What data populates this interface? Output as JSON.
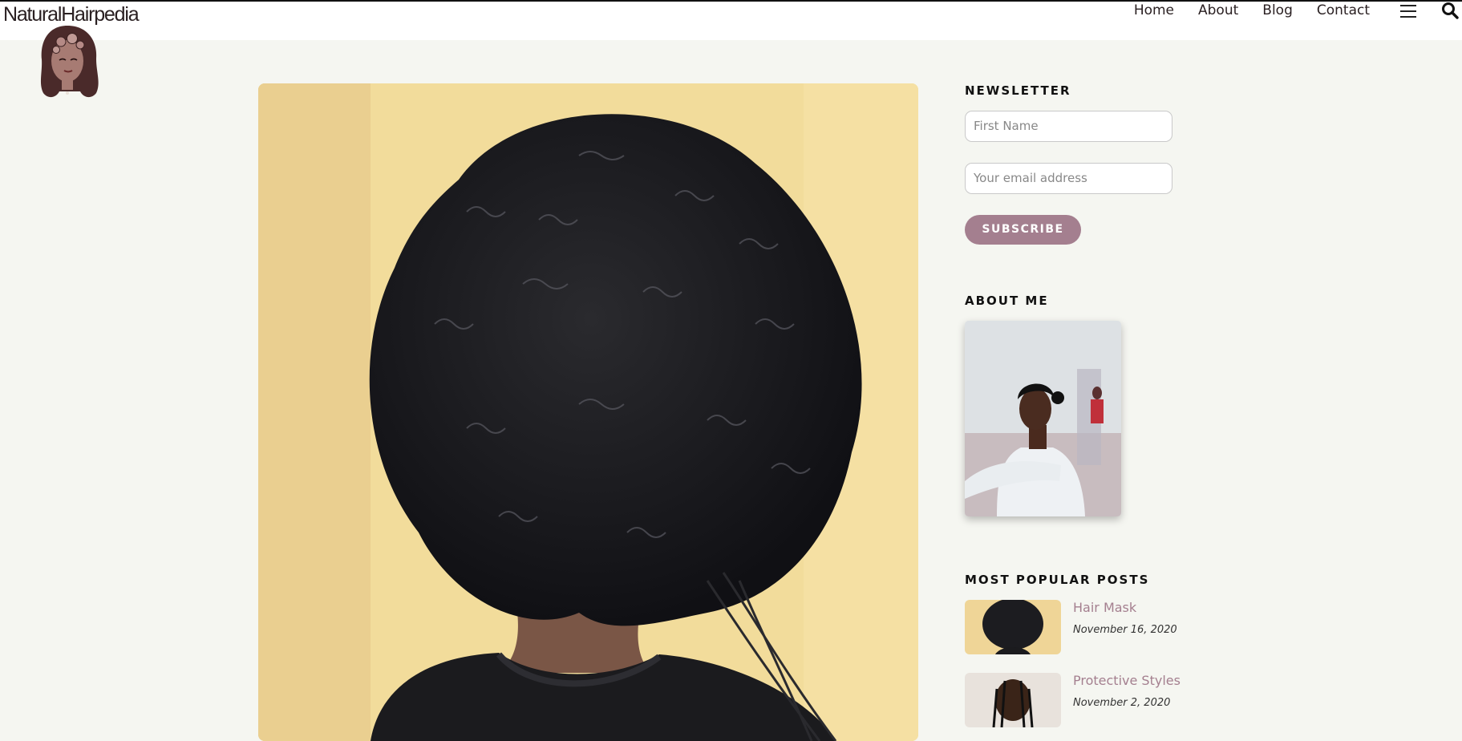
{
  "header": {
    "brand": "NaturalHairpedia",
    "nav": [
      "Home",
      "About",
      "Blog",
      "Contact"
    ]
  },
  "icons": {
    "menu": "hamburger-menu-icon",
    "search": "search-icon",
    "logo": "woman-with-flowers-logo"
  },
  "main": {
    "hero_image": "back-of-head-curly-natural-hair-photo"
  },
  "sidebar": {
    "newsletter": {
      "title": "NEWSLETTER",
      "first_name_placeholder": "First Name",
      "email_placeholder": "Your email address",
      "subscribe_label": "SUBSCRIBE"
    },
    "about": {
      "title": "ABOUT ME",
      "photo": "woman-in-white-turtleneck-photo"
    },
    "popular": {
      "title": "MOST POPULAR POSTS",
      "posts": [
        {
          "title": "Hair Mask",
          "date": "November 16, 2020"
        },
        {
          "title": "Protective Styles",
          "date": "November 2, 2020"
        }
      ]
    }
  },
  "colors": {
    "accent": "#a47f8f",
    "page_bg": "#f5f6f1",
    "header_bg": "#ffffff",
    "hero_bg": "#f2dc9b"
  }
}
